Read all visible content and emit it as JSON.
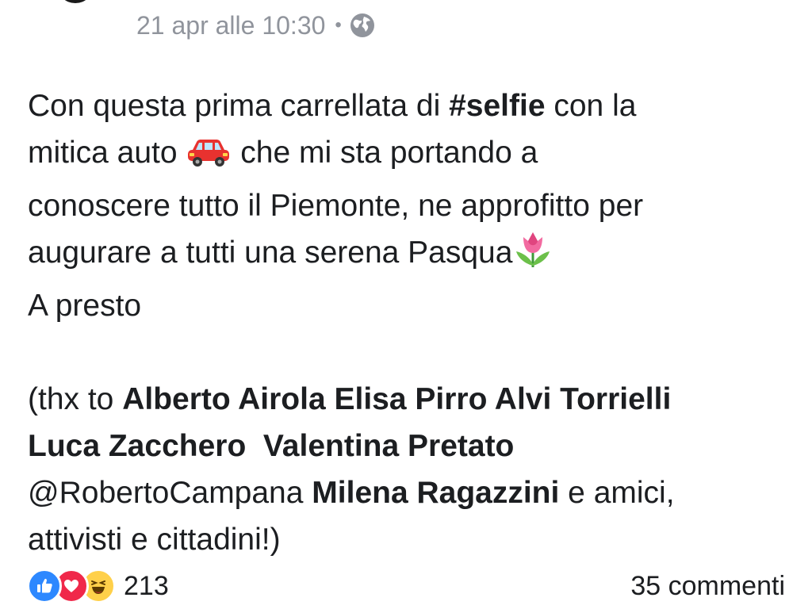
{
  "post": {
    "timestamp": "21 apr alle 10:30",
    "separator": "•",
    "privacy_icon": "globe-icon",
    "text": {
      "line1_pre": "Con questa prima carrellata di ",
      "line1_hashtag": "#selfie",
      "line1_post": " con la",
      "line2_pre": "mitica auto ",
      "line2_emoji": "car-emoji",
      "line2_post": " che mi sta portando a",
      "line3": "conoscere tutto il Piemonte, ne approfitto per",
      "line4_pre": "augurare a tutti una serena Pasqua",
      "line4_emoji": "tulip-emoji",
      "line5": "A presto",
      "line6_pre": "(thx to ",
      "line6_names": "Alberto Airola Elisa Pirro Alvi Torrielli",
      "line7_names": "Luca Zacchero  Valentina Pretato",
      "line8_mention": "@RobertoCampana ",
      "line8_name": "Milena Ragazzini",
      "line8_post": " e amici,",
      "line9": "attivisti e cittadini!)"
    }
  },
  "reactions": {
    "icons": [
      "like-icon",
      "love-icon",
      "haha-icon"
    ],
    "count": "213"
  },
  "comments": {
    "label": "35 commenti"
  },
  "colors": {
    "meta_text": "#90949c",
    "body_text": "#1c1e21",
    "like": "#2d88ff",
    "love": "#f0284a",
    "haha": "#ffd04a"
  }
}
